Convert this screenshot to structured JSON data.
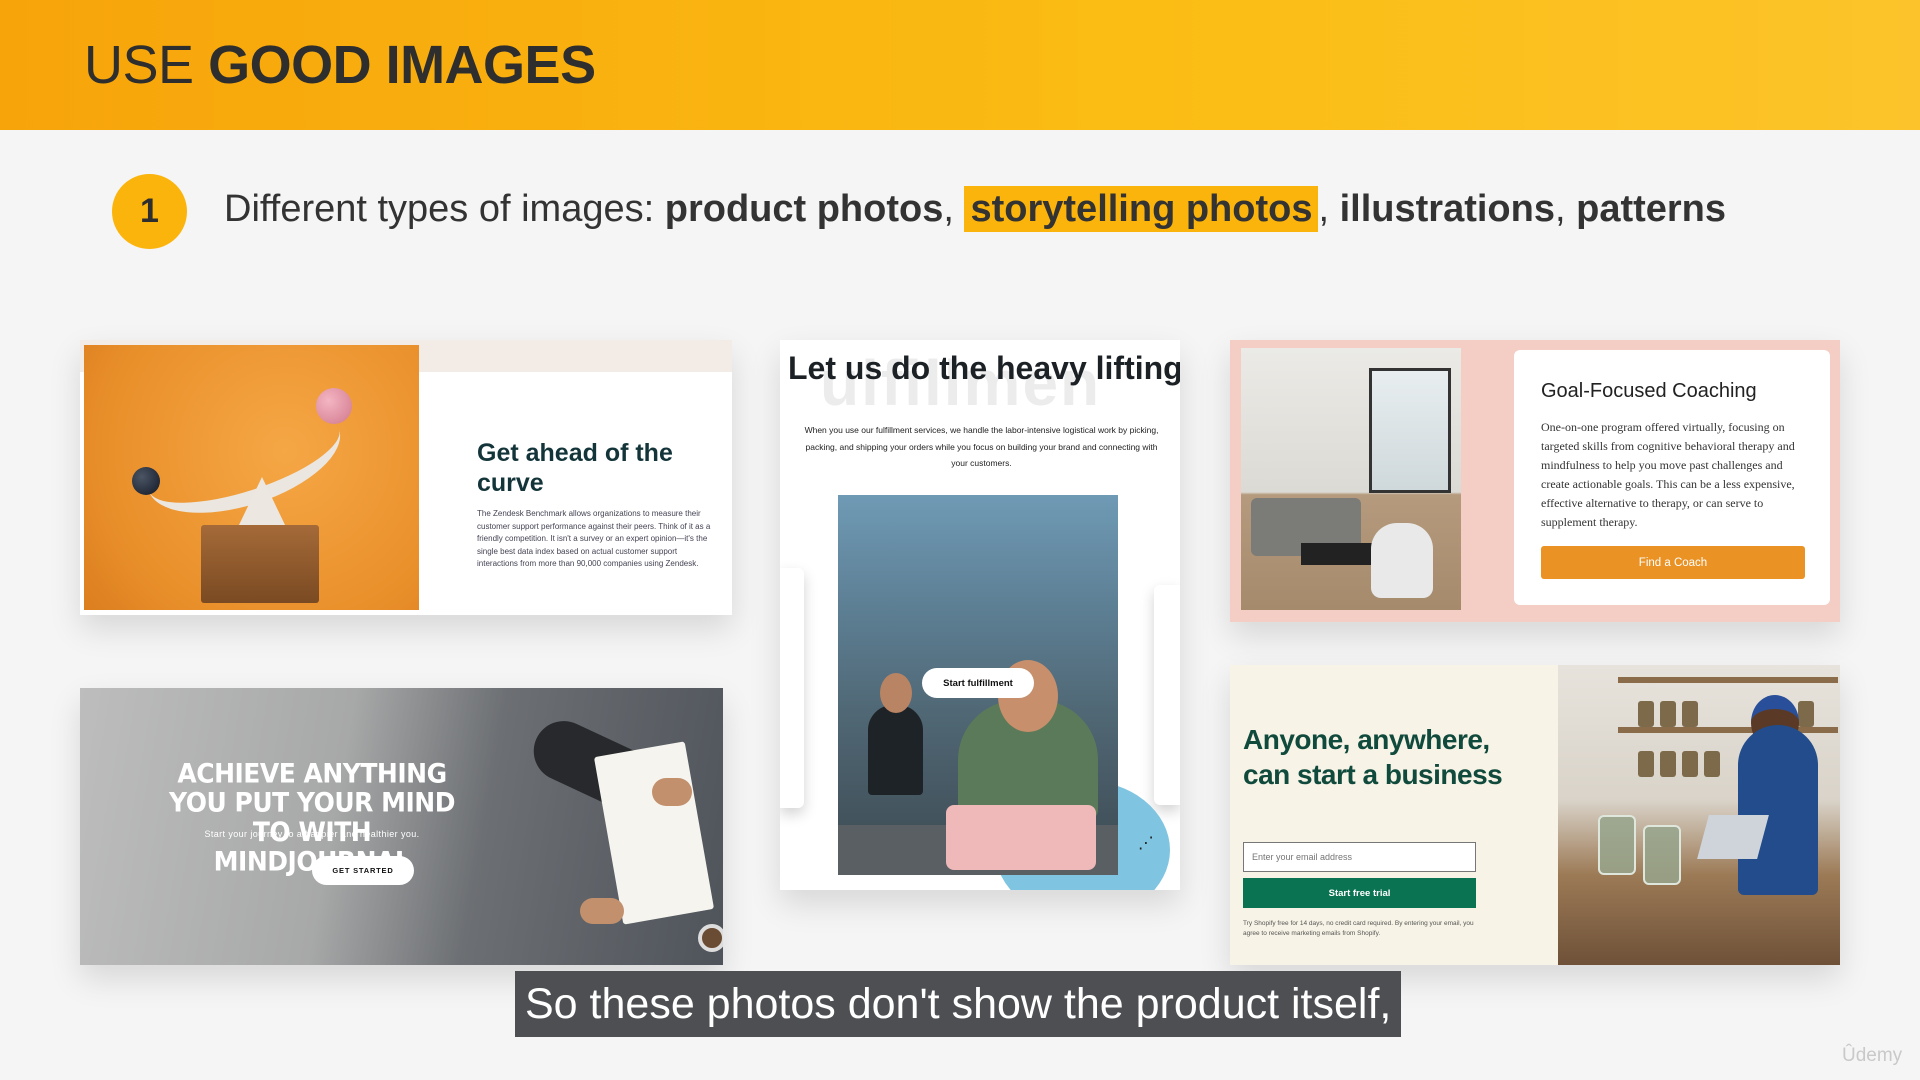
{
  "header": {
    "title_light": "USE",
    "title_bold": "GOOD IMAGES"
  },
  "step": {
    "number": "1",
    "intro": "Different types of images: ",
    "item1": "product photos",
    "sep1": ", ",
    "item2": "storytelling photos",
    "sep2": ", ",
    "item3": "illustrations",
    "sep3": ", ",
    "item4": "patterns"
  },
  "cards": {
    "zendesk": {
      "heading": "Get ahead of the curve",
      "body": "The Zendesk Benchmark allows organizations to measure their customer support performance against their peers. Think of it as a friendly competition. It isn't a survey or an expert opinion—it's the single best data index based on actual customer support interactions from more than 90,000 companies using Zendesk."
    },
    "fulfillment": {
      "bg_word": "ulfillmen",
      "title": "Let us do the heavy lifting",
      "subtitle": "When you use our fulfillment services, we handle the labor-intensive logistical work by picking, packing, and shipping your orders while you focus on building your brand and connecting with your customers.",
      "button": "Start fulfillment"
    },
    "coaching": {
      "title": "Goal-Focused Coaching",
      "body": "One-on-one program offered virtually, focusing on targeted skills from cognitive behavioral therapy and mindfulness to help you move past challenges and create actionable goals. This can be a less expensive, effective alternative to therapy, or can serve to supplement therapy.",
      "button": "Find a Coach"
    },
    "mindjournal": {
      "heading": "ACHIEVE ANYTHING YOU PUT YOUR MIND TO WITH MINDJOURNAL",
      "sub": "Start your journey to a happier and healthier you.",
      "button": "GET STARTED"
    },
    "shopify": {
      "heading": "Anyone, anywhere, can start a business",
      "email_placeholder": "Enter your email address",
      "button": "Start free trial",
      "fine_print": "Try Shopify free for 14 days, no credit card required. By entering your email, you agree to receive marketing emails from Shopify."
    }
  },
  "subtitle": "So these photos don't show the product itself,",
  "watermark": "Ûdemy",
  "colors": {
    "accent": "#fbb40b",
    "shopify_green": "#0a7352",
    "coach_orange": "#ea9224"
  }
}
